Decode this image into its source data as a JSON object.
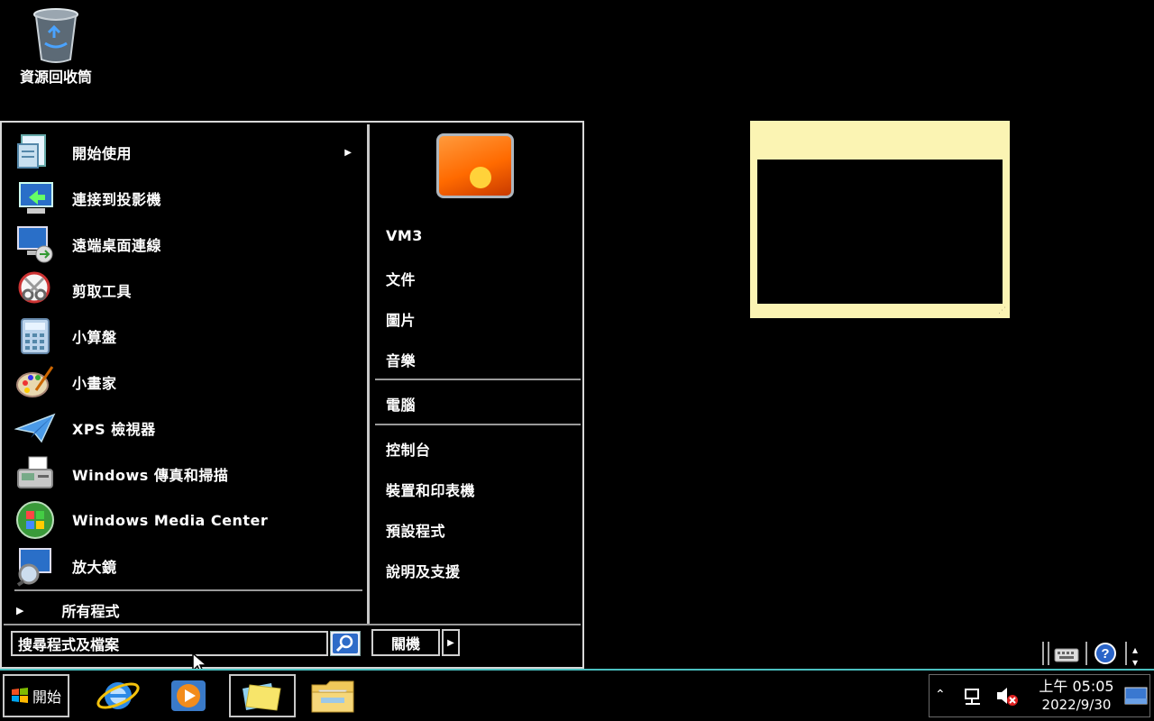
{
  "desktop": {
    "recycle_bin_label": "資源回收筒"
  },
  "start_menu": {
    "programs": [
      {
        "label": "開始使用",
        "icon": "getting-started-icon",
        "has_submenu": true
      },
      {
        "label": "連接到投影機",
        "icon": "projector-icon"
      },
      {
        "label": "遠端桌面連線",
        "icon": "remote-desktop-icon"
      },
      {
        "label": "剪取工具",
        "icon": "snipping-tool-icon"
      },
      {
        "label": "小算盤",
        "icon": "calculator-icon"
      },
      {
        "label": "小畫家",
        "icon": "paint-icon"
      },
      {
        "label": "XPS 檢視器",
        "icon": "xps-viewer-icon"
      },
      {
        "label": "Windows 傳真和掃描",
        "icon": "fax-scan-icon"
      },
      {
        "label": "Windows Media Center",
        "icon": "media-center-icon"
      },
      {
        "label": "放大鏡",
        "icon": "magnifier-icon"
      }
    ],
    "all_programs_label": "所有程式",
    "right_links": {
      "user": "VM3",
      "documents": "文件",
      "pictures": "圖片",
      "music": "音樂",
      "computer": "電腦",
      "control_panel": "控制台",
      "devices_printers": "裝置和印表機",
      "default_programs": "預設程式",
      "help_support": "說明及支援"
    },
    "search_placeholder": "搜尋程式及檔案",
    "shutdown_label": "關機"
  },
  "taskbar": {
    "start_label": "開始",
    "pinned": [
      {
        "name": "internet-explorer",
        "icon": "ie-icon"
      },
      {
        "name": "media-player",
        "icon": "media-player-icon"
      },
      {
        "name": "sticky-notes",
        "icon": "sticky-notes-icon",
        "active": true
      },
      {
        "name": "file-explorer",
        "icon": "folder-icon"
      }
    ],
    "clock": {
      "time": "上午 05:05",
      "date": "2022/9/30"
    }
  },
  "colors": {
    "taskbar_accent": "#4ac0c0",
    "sticky_note": "#fbf4b3",
    "menu_border": "#d8d8d8"
  }
}
